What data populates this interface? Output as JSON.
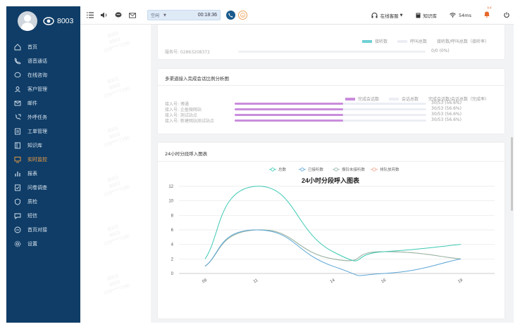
{
  "sidebar": {
    "extension": "8003",
    "menu": [
      {
        "label": "首页",
        "icon": "home-icon"
      },
      {
        "label": "语音通话",
        "icon": "phone-icon"
      },
      {
        "label": "在线咨询",
        "icon": "chat-icon"
      },
      {
        "label": "客户管理",
        "icon": "customer-icon"
      },
      {
        "label": "邮件",
        "icon": "mail-icon"
      },
      {
        "label": "外呼任务",
        "icon": "outbound-icon"
      },
      {
        "label": "工单管理",
        "icon": "ticket-icon"
      },
      {
        "label": "知识库",
        "icon": "book-icon"
      },
      {
        "label": "实时监控",
        "icon": "monitor-icon",
        "active": true
      },
      {
        "label": "报表",
        "icon": "report-icon"
      },
      {
        "label": "问卷调查",
        "icon": "survey-icon"
      },
      {
        "label": "质检",
        "icon": "quality-icon"
      },
      {
        "label": "短信",
        "icon": "sms-icon"
      },
      {
        "label": "首页对接",
        "icon": "link-icon"
      },
      {
        "label": "设置",
        "icon": "settings-icon"
      }
    ]
  },
  "topbar": {
    "status": "空闲",
    "timer": "00:18:36",
    "online_label": "在线客服",
    "kb_label": "知识库",
    "latency": "54ms",
    "bell_count": "12"
  },
  "watermark_lines": [
    "8003",
    "8003",
    "159****7190"
  ],
  "card1": {
    "legend": [
      "接听数",
      "呼叫总数",
      "接听数/呼叫总数（接听率）"
    ],
    "row_label": "服务号: 02863208372",
    "row_value": "0/0 (0%)",
    "fraction": 0
  },
  "card2": {
    "title": "多渠道接入完成会话比例分析图",
    "legend": [
      "完成会话数",
      "会话总数",
      "完成会话数/会话总数（完成率）"
    ],
    "rows": [
      {
        "label": "接入号:  博通",
        "value": "30/53 (56.6%)",
        "fraction": 0.566
      },
      {
        "label": "接入号:  企盈微网站",
        "value": "30/53 (56.6%)",
        "fraction": 0.566
      },
      {
        "label": "接入号:  测试站点",
        "value": "30/53 (56.6%)",
        "fraction": 0.566
      },
      {
        "label": "接入号:  新建网站测试站点",
        "value": "30/53 (56.6%)",
        "fraction": 0.566
      }
    ],
    "colors": {
      "fill": "#c98ddc",
      "track": "#eceef4"
    }
  },
  "card3": {
    "title": "24小时分段呼入图表"
  },
  "chart_data": {
    "type": "line",
    "title": "24小时分段呼入图表",
    "categories": [
      "09",
      "11",
      "14",
      "16",
      "19"
    ],
    "x": [
      9,
      11,
      14,
      16,
      19
    ],
    "ylim": [
      0,
      12
    ],
    "yticks": [
      0,
      2,
      4,
      6,
      8,
      10,
      12
    ],
    "grid": true,
    "legend_position": "top",
    "smooth": true,
    "series": [
      {
        "name": "总数",
        "color": "#3cc9b4",
        "values": [
          2,
          12,
          3,
          3,
          4
        ]
      },
      {
        "name": "已接听数",
        "color": "#5aa6d6",
        "values": [
          1,
          6,
          1,
          0,
          2
        ]
      },
      {
        "name": "振铃未接听数",
        "color": "#8fb8a8",
        "values": [
          1,
          6,
          2,
          3,
          2
        ]
      },
      {
        "name": "排队放弃数",
        "color": "#f0a48c",
        "values": [
          1,
          6,
          2,
          3,
          2
        ]
      }
    ]
  }
}
